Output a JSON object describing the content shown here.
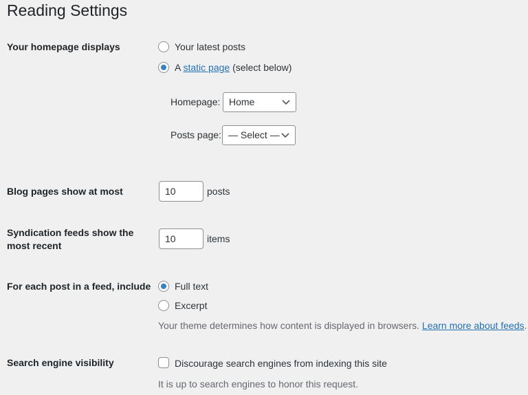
{
  "page_title": "Reading Settings",
  "homepage": {
    "label": "Your homepage displays",
    "option_latest": "Your latest posts",
    "option_static_prefix": "A ",
    "option_static_link": "static page",
    "option_static_suffix": " (select below)",
    "selected": "static",
    "homepage_label": "Homepage:",
    "homepage_value": "Home",
    "posts_page_label": "Posts page:",
    "posts_page_value": "— Select —"
  },
  "blog_pages": {
    "label": "Blog pages show at most",
    "value": "10",
    "unit": "posts"
  },
  "syndication": {
    "label_line1": "Syndication feeds show the",
    "label_line2": "most recent",
    "value": "10",
    "unit": "items"
  },
  "feed_content": {
    "label": "For each post in a feed, include",
    "option_full": "Full text",
    "option_excerpt": "Excerpt",
    "selected": "full",
    "description": "Your theme determines how content is displayed in browsers. ",
    "link": "Learn more about feeds",
    "description_end": "."
  },
  "search_visibility": {
    "label": "Search engine visibility",
    "checkbox_label": "Discourage search engines from indexing this site",
    "checked": false,
    "description": "It is up to search engines to honor this request."
  }
}
